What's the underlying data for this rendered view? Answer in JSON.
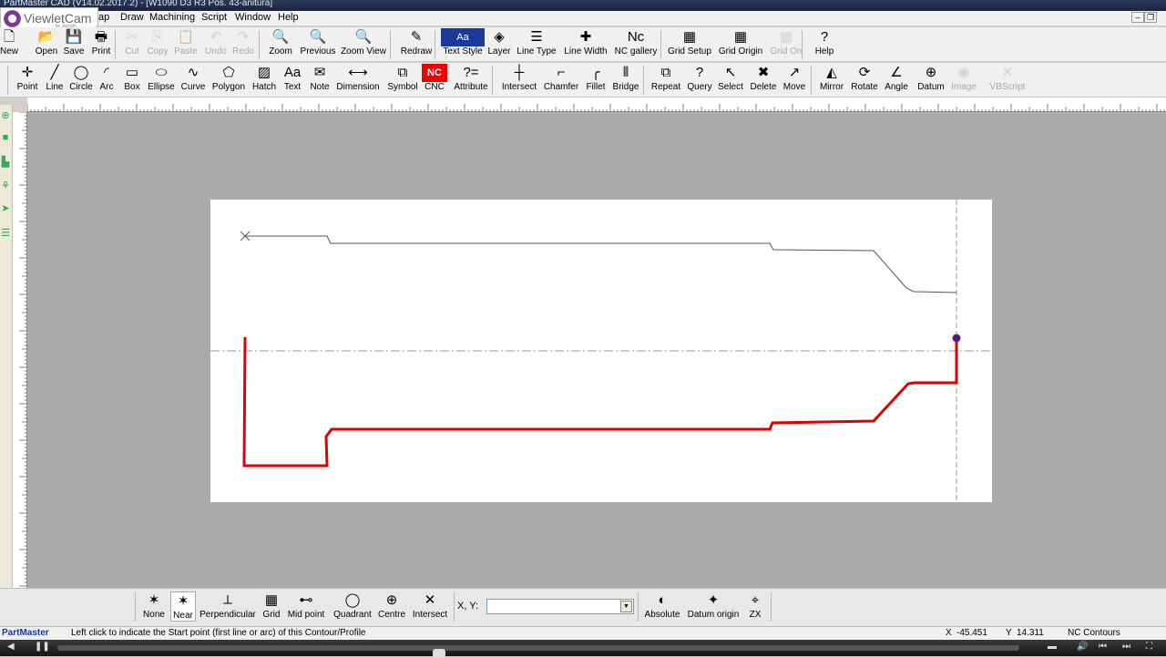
{
  "window": {
    "title": "PartMaster CAD (V14.02.2017.2) - [W1090 D3 R3 Pos. 43-anitura]"
  },
  "app": {
    "brand": "ViewletCam",
    "brand_by": "by Jetcam"
  },
  "menu": [
    "ap",
    "Draw",
    "Machining",
    "Script",
    "Window",
    "Help"
  ],
  "toolbar1": [
    {
      "label": "New",
      "icon": "new-file-icon",
      "glyph": "🗋"
    },
    {
      "label": "Open",
      "icon": "open-folder-icon",
      "glyph": "📂"
    },
    {
      "label": "Save",
      "icon": "save-icon",
      "glyph": "💾"
    },
    {
      "label": "Print",
      "icon": "print-icon",
      "glyph": "🖶"
    },
    {
      "label": "Cut",
      "icon": "cut-icon",
      "glyph": "✂",
      "disabled": true
    },
    {
      "label": "Copy",
      "icon": "copy-icon",
      "glyph": "⎘",
      "disabled": true
    },
    {
      "label": "Paste",
      "icon": "paste-icon",
      "glyph": "📋",
      "disabled": true
    },
    {
      "label": "Undo",
      "icon": "undo-icon",
      "glyph": "↶",
      "disabled": true
    },
    {
      "label": "Redo",
      "icon": "redo-icon",
      "glyph": "↷",
      "disabled": true
    },
    {
      "label": "Zoom",
      "icon": "zoom-icon",
      "glyph": "🔍"
    },
    {
      "label": "Previous",
      "icon": "zoom-previous-icon",
      "glyph": "🔍"
    },
    {
      "label": "Zoom View",
      "icon": "zoom-view-icon",
      "glyph": "🔍"
    },
    {
      "label": "Redraw",
      "icon": "pencil-icon",
      "glyph": "✎"
    },
    {
      "label": "Text Style",
      "icon": "text-style-icon",
      "glyph": "Aa"
    },
    {
      "label": "Layer",
      "icon": "layer-icon",
      "glyph": "◈"
    },
    {
      "label": "Line Type",
      "icon": "line-type-icon",
      "glyph": "☰"
    },
    {
      "label": "Line Width",
      "icon": "line-width-icon",
      "glyph": "✚"
    },
    {
      "label": "NC gallery",
      "icon": "nc-gallery-icon",
      "glyph": "Nc"
    },
    {
      "label": "Grid Setup",
      "icon": "grid-setup-icon",
      "glyph": "▦"
    },
    {
      "label": "Grid Origin",
      "icon": "grid-origin-icon",
      "glyph": "▦"
    },
    {
      "label": "Grid On",
      "icon": "grid-on-icon",
      "glyph": "▦",
      "disabled": true
    },
    {
      "label": "Help",
      "icon": "help-icon",
      "glyph": "?"
    }
  ],
  "toolbar2": [
    {
      "label": "Point",
      "icon": "point-icon",
      "glyph": "✛"
    },
    {
      "label": "Line",
      "icon": "line-icon",
      "glyph": "╱"
    },
    {
      "label": "Circle",
      "icon": "circle-icon",
      "glyph": "◯"
    },
    {
      "label": "Arc",
      "icon": "arc-icon",
      "glyph": "◜"
    },
    {
      "label": "Box",
      "icon": "box-icon",
      "glyph": "▭"
    },
    {
      "label": "Ellipse",
      "icon": "ellipse-icon",
      "glyph": "⬭"
    },
    {
      "label": "Curve",
      "icon": "curve-icon",
      "glyph": "∿"
    },
    {
      "label": "Polygon",
      "icon": "polygon-icon",
      "glyph": "⬠"
    },
    {
      "label": "Hatch",
      "icon": "hatch-icon",
      "glyph": "▨"
    },
    {
      "label": "Text",
      "icon": "text-icon",
      "glyph": "Aa"
    },
    {
      "label": "Note",
      "icon": "note-icon",
      "glyph": "✉"
    },
    {
      "label": "Dimension",
      "icon": "dimension-icon",
      "glyph": "⟷"
    },
    {
      "label": "Symbol",
      "icon": "symbol-icon",
      "glyph": "⧉"
    },
    {
      "label": "CNC",
      "icon": "cnc-icon",
      "glyph": "NC"
    },
    {
      "label": "Attribute",
      "icon": "attribute-icon",
      "glyph": "?="
    },
    {
      "label": "Intersect",
      "icon": "intersect-icon",
      "glyph": "┼"
    },
    {
      "label": "Chamfer",
      "icon": "chamfer-icon",
      "glyph": "⌐"
    },
    {
      "label": "Fillet",
      "icon": "fillet-icon",
      "glyph": "╭"
    },
    {
      "label": "Bridge",
      "icon": "bridge-icon",
      "glyph": "⫴"
    },
    {
      "label": "Repeat",
      "icon": "repeat-icon",
      "glyph": "⧉"
    },
    {
      "label": "Query",
      "icon": "query-icon",
      "glyph": "?"
    },
    {
      "label": "Select",
      "icon": "select-arrow-icon",
      "glyph": "↖"
    },
    {
      "label": "Delete",
      "icon": "delete-icon",
      "glyph": "✖"
    },
    {
      "label": "Move",
      "icon": "move-icon",
      "glyph": "↗"
    },
    {
      "label": "Mirror",
      "icon": "mirror-icon",
      "glyph": "◭"
    },
    {
      "label": "Rotate",
      "icon": "rotate-icon",
      "glyph": "⟳"
    },
    {
      "label": "Angle",
      "icon": "angle-icon",
      "glyph": "∠"
    },
    {
      "label": "Datum",
      "icon": "datum-icon",
      "glyph": "⊕"
    },
    {
      "label": "Image",
      "icon": "image-icon",
      "glyph": "◉",
      "disabled": true
    },
    {
      "label": "VBScript",
      "icon": "vbscript-icon",
      "glyph": "✕",
      "disabled": true
    }
  ],
  "snap": [
    {
      "label": "None",
      "icon": "snap-none-icon",
      "glyph": "✶"
    },
    {
      "label": "Near",
      "icon": "snap-near-icon",
      "glyph": "✶",
      "active": true
    },
    {
      "label": "Perpendicular",
      "icon": "snap-perpendicular-icon",
      "glyph": "⟂"
    },
    {
      "label": "Grid",
      "icon": "snap-grid-icon",
      "glyph": "▦"
    },
    {
      "label": "Mid point",
      "icon": "snap-midpoint-icon",
      "glyph": "⊷"
    },
    {
      "label": "Quadrant",
      "icon": "snap-quadrant-icon",
      "glyph": "◯"
    },
    {
      "label": "Centre",
      "icon": "snap-centre-icon",
      "glyph": "⊕"
    },
    {
      "label": "Intersect",
      "icon": "snap-intersect-icon",
      "glyph": "✕"
    }
  ],
  "coord": {
    "label": "X, Y:",
    "value": ""
  },
  "origin": [
    {
      "label": "Absolute",
      "icon": "absolute-origin-icon",
      "glyph": "◐"
    },
    {
      "label": "Datum origin",
      "icon": "datum-origin-icon",
      "glyph": "✦"
    },
    {
      "label": "ZX",
      "icon": "zx-plane-icon",
      "glyph": "⌖"
    }
  ],
  "status": {
    "app": "PartMaster",
    "message": "Left click to indicate the Start point (first line or arc) of this Contour/Profile",
    "x_label": "X",
    "x": "-45.451",
    "y_label": "Y",
    "y": "14.311",
    "mode": "NC Contours"
  },
  "colors": {
    "profile": "#e00000",
    "centerline": "#888888",
    "canvas": "#abaaab"
  }
}
